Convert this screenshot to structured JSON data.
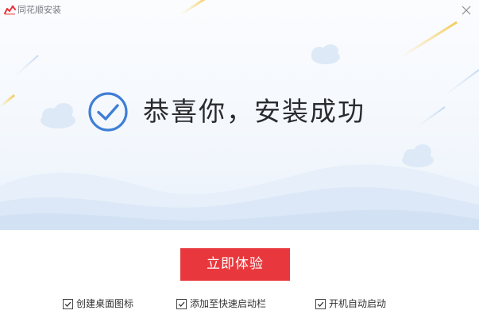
{
  "window": {
    "title": "同花顺安装",
    "close_icon": "close-icon",
    "logo_icon": "app-logo-icon"
  },
  "hero": {
    "message": "恭喜你，安装成功",
    "status_icon": "check-circle-icon"
  },
  "actions": {
    "primary_label": "立即体验"
  },
  "options": [
    {
      "label": "创建桌面图标",
      "checked": true
    },
    {
      "label": "添加至快速启动栏",
      "checked": true
    },
    {
      "label": "开机自动启动",
      "checked": true
    }
  ],
  "colors": {
    "accent_red": "#e8383d",
    "check_blue": "#3f7fd6",
    "hero_bg": "#f4f8fd"
  }
}
